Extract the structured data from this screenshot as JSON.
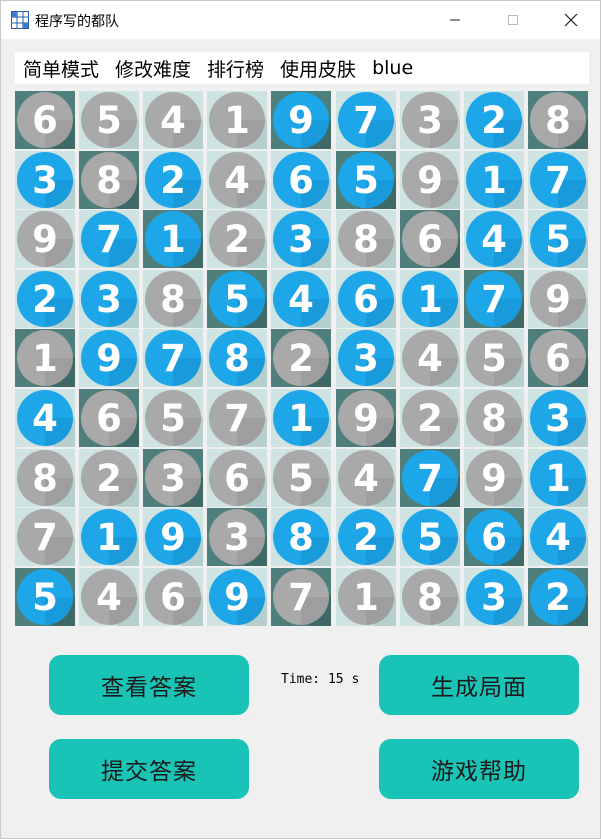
{
  "window": {
    "title": "程序写的都队"
  },
  "menu": [
    {
      "label": "简单模式"
    },
    {
      "label": "修改难度"
    },
    {
      "label": "排行榜"
    },
    {
      "label": "使用皮肤"
    },
    {
      "label": "blue"
    }
  ],
  "board": {
    "rows": [
      [
        [
          6,
          "g"
        ],
        [
          5,
          "g"
        ],
        [
          4,
          "g"
        ],
        [
          1,
          "g"
        ],
        [
          9,
          "b"
        ],
        [
          7,
          "b"
        ],
        [
          3,
          "g"
        ],
        [
          2,
          "b"
        ],
        [
          8,
          "g"
        ]
      ],
      [
        [
          3,
          "b"
        ],
        [
          8,
          "g"
        ],
        [
          2,
          "b"
        ],
        [
          4,
          "g"
        ],
        [
          6,
          "b"
        ],
        [
          5,
          "b"
        ],
        [
          9,
          "g"
        ],
        [
          1,
          "b"
        ],
        [
          7,
          "b"
        ]
      ],
      [
        [
          9,
          "g"
        ],
        [
          7,
          "b"
        ],
        [
          1,
          "b"
        ],
        [
          2,
          "g"
        ],
        [
          3,
          "b"
        ],
        [
          8,
          "g"
        ],
        [
          6,
          "g"
        ],
        [
          4,
          "b"
        ],
        [
          5,
          "b"
        ]
      ],
      [
        [
          2,
          "b"
        ],
        [
          3,
          "b"
        ],
        [
          8,
          "g"
        ],
        [
          5,
          "b"
        ],
        [
          4,
          "b"
        ],
        [
          6,
          "b"
        ],
        [
          1,
          "b"
        ],
        [
          7,
          "b"
        ],
        [
          9,
          "g"
        ]
      ],
      [
        [
          1,
          "g"
        ],
        [
          9,
          "b"
        ],
        [
          7,
          "b"
        ],
        [
          8,
          "b"
        ],
        [
          2,
          "g"
        ],
        [
          3,
          "b"
        ],
        [
          4,
          "g"
        ],
        [
          5,
          "g"
        ],
        [
          6,
          "g"
        ]
      ],
      [
        [
          4,
          "b"
        ],
        [
          6,
          "g"
        ],
        [
          5,
          "g"
        ],
        [
          7,
          "g"
        ],
        [
          1,
          "b"
        ],
        [
          9,
          "g"
        ],
        [
          2,
          "g"
        ],
        [
          8,
          "g"
        ],
        [
          3,
          "b"
        ]
      ],
      [
        [
          8,
          "g"
        ],
        [
          2,
          "g"
        ],
        [
          3,
          "g"
        ],
        [
          6,
          "g"
        ],
        [
          5,
          "g"
        ],
        [
          4,
          "g"
        ],
        [
          7,
          "b"
        ],
        [
          9,
          "g"
        ],
        [
          1,
          "b"
        ]
      ],
      [
        [
          7,
          "g"
        ],
        [
          1,
          "b"
        ],
        [
          9,
          "b"
        ],
        [
          3,
          "g"
        ],
        [
          8,
          "b"
        ],
        [
          2,
          "b"
        ],
        [
          5,
          "b"
        ],
        [
          6,
          "b"
        ],
        [
          4,
          "b"
        ]
      ],
      [
        [
          5,
          "b"
        ],
        [
          4,
          "g"
        ],
        [
          6,
          "g"
        ],
        [
          9,
          "b"
        ],
        [
          7,
          "g"
        ],
        [
          1,
          "g"
        ],
        [
          8,
          "g"
        ],
        [
          3,
          "b"
        ],
        [
          2,
          "b"
        ]
      ]
    ],
    "colors": {
      "blue": "#1ea7e8",
      "grey": "#a9a9a9",
      "tile_dark": "#4f7f7c",
      "tile_light": "#cfe3e3",
      "digit": "#ffffff"
    }
  },
  "buttons": {
    "view_answer": "查看答案",
    "generate": "生成局面",
    "submit": "提交答案",
    "help": "游戏帮助",
    "accent": "#19c3b6"
  },
  "timer": {
    "text": "Time: 15 s"
  }
}
